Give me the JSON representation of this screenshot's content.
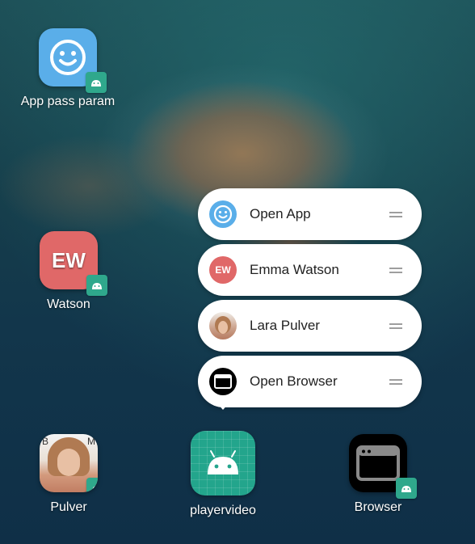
{
  "home": {
    "apps": [
      {
        "label": "App pass param",
        "icon": "smiley-icon"
      },
      {
        "label": "Watson",
        "icon": "avatar-ew",
        "initials": "EW"
      },
      {
        "label": "Pulver",
        "icon": "photo-avatar",
        "marks": [
          "B",
          "M"
        ]
      },
      {
        "label": "playervideo",
        "icon": "android-icon"
      },
      {
        "label": "Browser",
        "icon": "browser-icon"
      }
    ]
  },
  "shortcuts": [
    {
      "label": "Open App",
      "icon": "smiley-icon"
    },
    {
      "label": "Emma Watson",
      "icon": "avatar-ew",
      "initials": "EW"
    },
    {
      "label": "Lara Pulver",
      "icon": "photo-avatar"
    },
    {
      "label": "Open Browser",
      "icon": "browser-icon"
    }
  ],
  "colors": {
    "smiley": "#5aaee9",
    "ew_avatar": "#e06868",
    "android_green": "#2fa88c",
    "popup_bg": "#ffffff"
  }
}
